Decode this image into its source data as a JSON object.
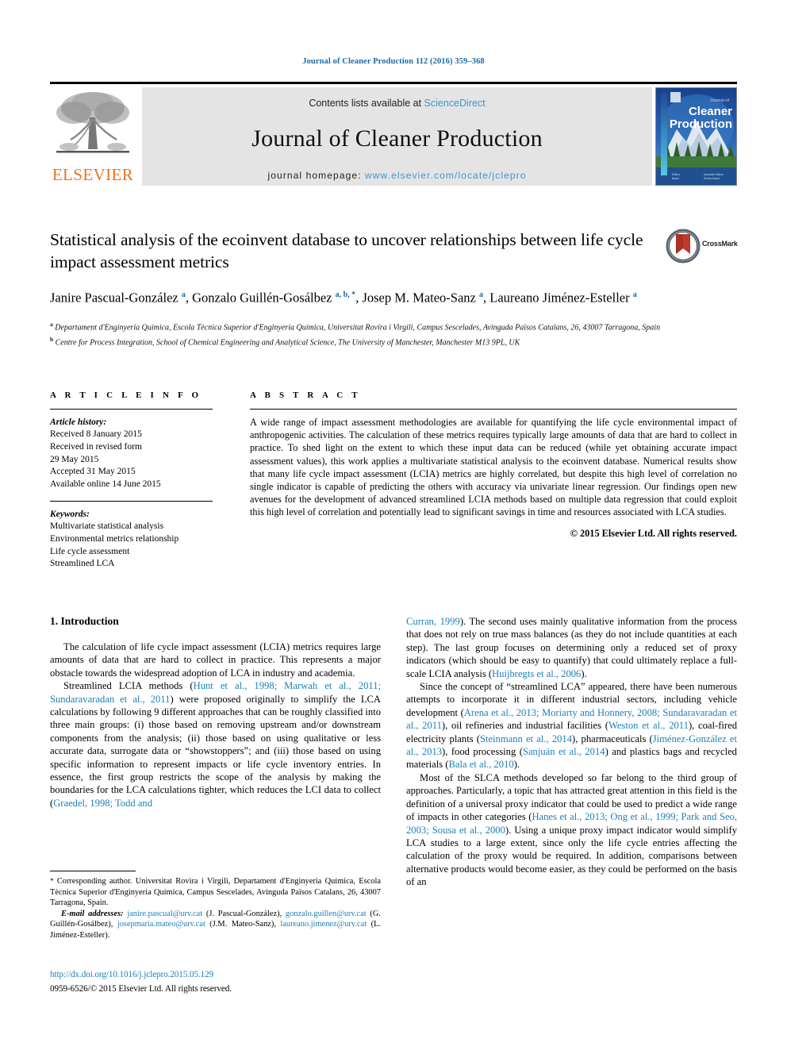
{
  "running_head": "Journal of Cleaner Production 112 (2016) 359–368",
  "masthead": {
    "publisher_name": "ELSEVIER",
    "contents_prefix": "Contents lists available at ",
    "contents_link": "ScienceDirect",
    "journal_title": "Journal of Cleaner Production",
    "homepage_prefix": "journal homepage: ",
    "homepage_url": "www.elsevier.com/locate/jclepro",
    "cover_title_line1": "Journal of",
    "cover_title_line2": "Cleaner",
    "cover_title_line3": "Production"
  },
  "article": {
    "title": "Statistical analysis of the ecoinvent database to uncover relationships between life cycle impact assessment metrics",
    "crossmark_label": "CrossMark",
    "authors_html": "Janire Pascual-González <sup class=\"aff-mark\">a</sup>, Gonzalo Guillén-Gosálbez <sup class=\"aff-mark\">a, b, *</sup>, Josep M. Mateo-Sanz <sup class=\"aff-mark\">a</sup>, Laureano Jiménez-Esteller <sup class=\"aff-mark\">a</sup>",
    "affiliation_a": "Departament d'Enginyeria Química, Escola Tècnica Superior d'Enginyeria Química, Universitat Rovira i Virgili, Campus Sescelades, Avinguda Països Catalans, 26, 43007 Tarragona, Spain",
    "affiliation_b": "Centre for Process Integration, School of Chemical Engineering and Analytical Science, The University of Manchester, Manchester M13 9PL, UK"
  },
  "article_info": {
    "heading": "A R T I C L E  I N F O",
    "history_label": "Article history:",
    "history": [
      "Received 8 January 2015",
      "Received in revised form",
      "29 May 2015",
      "Accepted 31 May 2015",
      "Available online 14 June 2015"
    ],
    "keywords_label": "Keywords:",
    "keywords": [
      "Multivariate statistical analysis",
      "Environmental metrics relationship",
      "Life cycle assessment",
      "Streamlined LCA"
    ]
  },
  "abstract": {
    "heading": "A B S T R A C T",
    "body": "A wide range of impact assessment methodologies are available for quantifying the life cycle environmental impact of anthropogenic activities. The calculation of these metrics requires typically large amounts of data that are hard to collect in practice. To shed light on the extent to which these input data can be reduced (while yet obtaining accurate impact assessment values), this work applies a multivariate statistical analysis to the ecoinvent database. Numerical results show that many life cycle impact assessment (LCIA) metrics are highly correlated, but despite this high level of correlation no single indicator is capable of predicting the others with accuracy via univariate linear regression. Our findings open new avenues for the development of advanced streamlined LCIA methods based on multiple data regression that could exploit this high level of correlation and potentially lead to significant savings in time and resources associated with LCA studies.",
    "copyright": "© 2015 Elsevier Ltd. All rights reserved."
  },
  "introduction": {
    "section_title": "1. Introduction",
    "para1": "The calculation of life cycle impact assessment (LCIA) metrics requires large amounts of data that are hard to collect in practice. This represents a major obstacle towards the widespread adoption of LCA in industry and academia.",
    "para2_html": "Streamlined LCIA methods (<span class=\"ref\">Hunt et al., 1998; Marwah et al., 2011; Sundaravaradan et al., 2011</span>) were proposed originally to simplify the LCA calculations by following 9 different approaches that can be roughly classified into three main groups: (i) those based on removing upstream and/or downstream components from the analysis; (ii) those based on using qualitative or less accurate data, surrogate data or &ldquo;showstoppers&rdquo;; and (iii) those based on using specific information to represent impacts or life cycle inventory entries. In essence, the first group restricts the scope of the analysis by making the boundaries for the LCA calculations tighter, which reduces the LCI data to collect (<span class=\"ref\">Graedel, 1998; Todd and</span>",
    "para2_cont_html": "<span class=\"ref\">Curran, 1999</span>). The second uses mainly qualitative information from the process that does not rely on true mass balances (as they do not include quantities at each step). The last group focuses on determining only a reduced set of proxy indicators (which should be easy to quantify) that could ultimately replace a full-scale LCIA analysis (<span class=\"ref\">Huijbregts et al., 2006</span>).",
    "para3_html": "Since the concept of &ldquo;streamlined LCA&rdquo; appeared, there have been numerous attempts to incorporate it in different industrial sectors, including vehicle development (<span class=\"ref\">Arena et al., 2013; Moriarty and Honnery, 2008; Sundaravaradan et al., 2011</span>), oil refineries and industrial facilities (<span class=\"ref\">Weston et al., 2011</span>), coal-fired electricity plants (<span class=\"ref\">Steinmann et al., 2014</span>), pharmaceuticals (<span class=\"ref\">Jiménez-González et al., 2013</span>), food processing (<span class=\"ref\">Sanjuán et al., 2014</span>) and plastics bags and recycled materials (<span class=\"ref\">Bala et al., 2010</span>).",
    "para4_html": "Most of the SLCA methods developed so far belong to the third group of approaches. Particularly, a topic that has attracted great attention in this field is the definition of a universal proxy indicator that could be used to predict a wide range of impacts in other categories (<span class=\"ref\">Hanes et al., 2013; Ong et al., 1999; Park and Seo, 2003; Sousa et al., 2000</span>). Using a unique proxy impact indicator would simplify LCA studies to a large extent, since only the life cycle entries affecting the calculation of the proxy would be required. In addition, comparisons between alternative products would become easier, as they could be performed on the basis of an"
  },
  "footnote": {
    "corresponding_html": "<span class=\"fn-star\">*</span> Corresponding author. Universitat Rovira i Virgili, Departament d'Enginyeria Química, Escola Tècnica Superior d'Enginyeria Química, Campus Sescelades, Avinguda Països Catalans, 26, 43007 Tarragona, Spain.",
    "emails_html": "<span class=\"ital\">E-mail addresses:</span> <span class=\"ref\">janire.pascual@urv.cat</span> (J. Pascual-González), <span class=\"ref\">gonzalo.guillen@urv.cat</span> (G. Guillén-Gosálbez), <span class=\"ref\">josepmaria.mateo@urv.cat</span> (J.M. Mateo-Sanz), <span class=\"ref\">laureano.jimenez@urv.cat</span> (L. Jiménez-Esteller).",
    "doi": "http://dx.doi.org/10.1016/j.jclepro.2015.05.129",
    "issn": "0959-6526/© 2015 Elsevier Ltd. All rights reserved."
  },
  "colors": {
    "link_blue": "#1b7fb8",
    "header_blue": "#1b6ca8",
    "elsevier_orange": "#e87422",
    "masthead_grey": "#e4e4e4"
  }
}
